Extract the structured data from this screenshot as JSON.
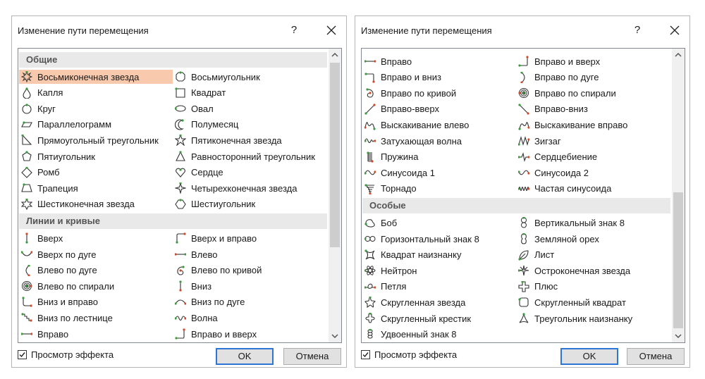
{
  "colors": {
    "accent": "#2f75d6",
    "selection": "#f8c9ad",
    "icon_green": "#3c9a3c",
    "icon_red": "#d04a2a"
  },
  "left_dialog": {
    "title": "Изменение пути перемещения",
    "help_label": "?",
    "close_icon": "close-icon",
    "categories": [
      {
        "name": "Общие",
        "items": [
          {
            "label": "Восьмиконечная звезда",
            "icon": "star8-icon",
            "selected": true
          },
          {
            "label": "Восьмиугольник",
            "icon": "octagon-icon"
          },
          {
            "label": "Капля",
            "icon": "teardrop-icon"
          },
          {
            "label": "Квадрат",
            "icon": "square-icon"
          },
          {
            "label": "Круг",
            "icon": "circle-icon"
          },
          {
            "label": "Овал",
            "icon": "oval-icon"
          },
          {
            "label": "Параллелограмм",
            "icon": "parallelogram-icon"
          },
          {
            "label": "Полумесяц",
            "icon": "crescent-icon"
          },
          {
            "label": "Прямоугольный треугольник",
            "icon": "right-triangle-icon"
          },
          {
            "label": "Пятиконечная звезда",
            "icon": "star5-icon"
          },
          {
            "label": "Пятиугольник",
            "icon": "pentagon-icon"
          },
          {
            "label": "Равносторонний треугольник",
            "icon": "triangle-icon"
          },
          {
            "label": "Ромб",
            "icon": "diamond-icon"
          },
          {
            "label": "Сердце",
            "icon": "heart-icon"
          },
          {
            "label": "Трапеция",
            "icon": "trapezoid-icon"
          },
          {
            "label": "Четырехконечная звезда",
            "icon": "star4-icon"
          },
          {
            "label": "Шестиконечная звезда",
            "icon": "star6-icon"
          },
          {
            "label": "Шестиугольник",
            "icon": "hexagon-icon"
          }
        ]
      },
      {
        "name": "Линии и кривые",
        "items": [
          {
            "label": "Вверх",
            "icon": "line-up-icon"
          },
          {
            "label": "Вверх и вправо",
            "icon": "up-right-icon"
          },
          {
            "label": "Вверх по дуге",
            "icon": "arc-up-icon"
          },
          {
            "label": "Влево",
            "icon": "line-left-icon"
          },
          {
            "label": "Влево по дуге",
            "icon": "arc-left-icon"
          },
          {
            "label": "Влево по кривой",
            "icon": "curve-left-icon"
          },
          {
            "label": "Влево по спирали",
            "icon": "spiral-left-icon"
          },
          {
            "label": "Вниз",
            "icon": "line-down-icon"
          },
          {
            "label": "Вниз и вправо",
            "icon": "down-right-icon"
          },
          {
            "label": "Вниз по дуге",
            "icon": "arc-down-icon"
          },
          {
            "label": "Вниз по лестнице",
            "icon": "stairs-down-icon"
          },
          {
            "label": "Волна",
            "icon": "wave-icon"
          },
          {
            "label": "Вправо",
            "icon": "line-right-icon"
          },
          {
            "label": "Вправо и вверх",
            "icon": "right-up-icon"
          }
        ]
      }
    ],
    "preview_label": "Просмотр эффекта",
    "preview_checked": true,
    "ok_label": "OK",
    "cancel_label": "Отмена"
  },
  "right_dialog": {
    "title": "Изменение пути перемещения",
    "help_label": "?",
    "close_icon": "close-icon",
    "top_items": [
      {
        "label": "Вправо",
        "icon": "line-right-icon"
      },
      {
        "label": "Вправо и вверх",
        "icon": "right-up-icon"
      },
      {
        "label": "Вправо и вниз",
        "icon": "right-down-icon"
      },
      {
        "label": "Вправо по дуге",
        "icon": "arc-right-icon"
      },
      {
        "label": "Вправо по кривой",
        "icon": "curve-right-icon"
      },
      {
        "label": "Вправо по спирали",
        "icon": "spiral-right-icon"
      },
      {
        "label": "Вправо-вверх",
        "icon": "diagonal-up-right-icon"
      },
      {
        "label": "Вправо-вниз",
        "icon": "diagonal-down-right-icon"
      },
      {
        "label": "Выскакивание влево",
        "icon": "bounce-left-icon"
      },
      {
        "label": "Выскакивание вправо",
        "icon": "bounce-right-icon"
      },
      {
        "label": "Затухающая волна",
        "icon": "decaying-wave-icon"
      },
      {
        "label": "Зигзаг",
        "icon": "zigzag-icon"
      },
      {
        "label": "Пружина",
        "icon": "spring-icon"
      },
      {
        "label": "Сердцебиение",
        "icon": "heartbeat-icon"
      },
      {
        "label": "Синусоида 1",
        "icon": "sine1-icon"
      },
      {
        "label": "Синусоида 2",
        "icon": "sine2-icon"
      },
      {
        "label": "Торнадо",
        "icon": "tornado-icon"
      },
      {
        "label": "Частая синусоида",
        "icon": "sine-frequent-icon"
      }
    ],
    "special_category": {
      "name": "Особые",
      "items": [
        {
          "label": "Боб",
          "icon": "bean-icon"
        },
        {
          "label": "Вертикальный знак 8",
          "icon": "figure8-vertical-icon"
        },
        {
          "label": "Горизонтальный знак 8",
          "icon": "figure8-horizontal-icon"
        },
        {
          "label": "Земляной орех",
          "icon": "peanut-icon"
        },
        {
          "label": "Квадрат наизнанку",
          "icon": "inverted-square-icon"
        },
        {
          "label": "Лист",
          "icon": "leaf-icon"
        },
        {
          "label": "Нейтрон",
          "icon": "neutron-icon"
        },
        {
          "label": "Остроконечная звезда",
          "icon": "pointy-star-icon"
        },
        {
          "label": "Петля",
          "icon": "loop-icon"
        },
        {
          "label": "Плюс",
          "icon": "plus-icon"
        },
        {
          "label": "Скругленная звезда",
          "icon": "rounded-star-icon"
        },
        {
          "label": "Скругленный квадрат",
          "icon": "rounded-square-icon"
        },
        {
          "label": "Скругленный крестик",
          "icon": "rounded-cross-icon"
        },
        {
          "label": "Треугольник наизнанку",
          "icon": "inverted-triangle-icon"
        },
        {
          "label": "Удвоенный знак 8",
          "icon": "double-figure8-icon"
        }
      ]
    },
    "preview_label": "Просмотр эффекта",
    "preview_checked": true,
    "ok_label": "OK",
    "cancel_label": "Отмена"
  }
}
